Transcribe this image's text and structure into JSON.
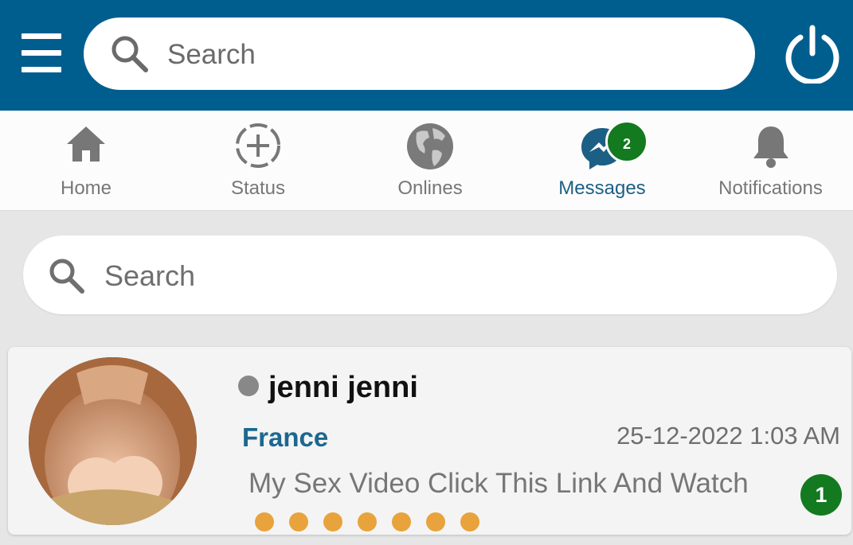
{
  "colors": {
    "primary": "#005e8f",
    "active_tab": "#1c5f85",
    "badge": "#137a1f",
    "icon_gray": "#777777"
  },
  "header": {
    "menu_icon": "hamburger-icon",
    "search_placeholder": "Search",
    "power_icon": "power-icon"
  },
  "tabs": [
    {
      "label": "Home",
      "icon": "home-icon"
    },
    {
      "label": "Status",
      "icon": "add-status-icon"
    },
    {
      "label": "Onlines",
      "icon": "globe-icon"
    },
    {
      "label": "Messages",
      "icon": "messenger-icon",
      "active": true,
      "badge": "2"
    },
    {
      "label": "Notifications",
      "icon": "bell-icon"
    }
  ],
  "list_search": {
    "placeholder": "Search"
  },
  "conversations": [
    {
      "name": "jenni jenni",
      "country": "France",
      "timestamp": "25-12-2022 1:03 AM",
      "preview": "My Sex Video Click This Link And Watch",
      "unread": "1",
      "online": false
    }
  ]
}
